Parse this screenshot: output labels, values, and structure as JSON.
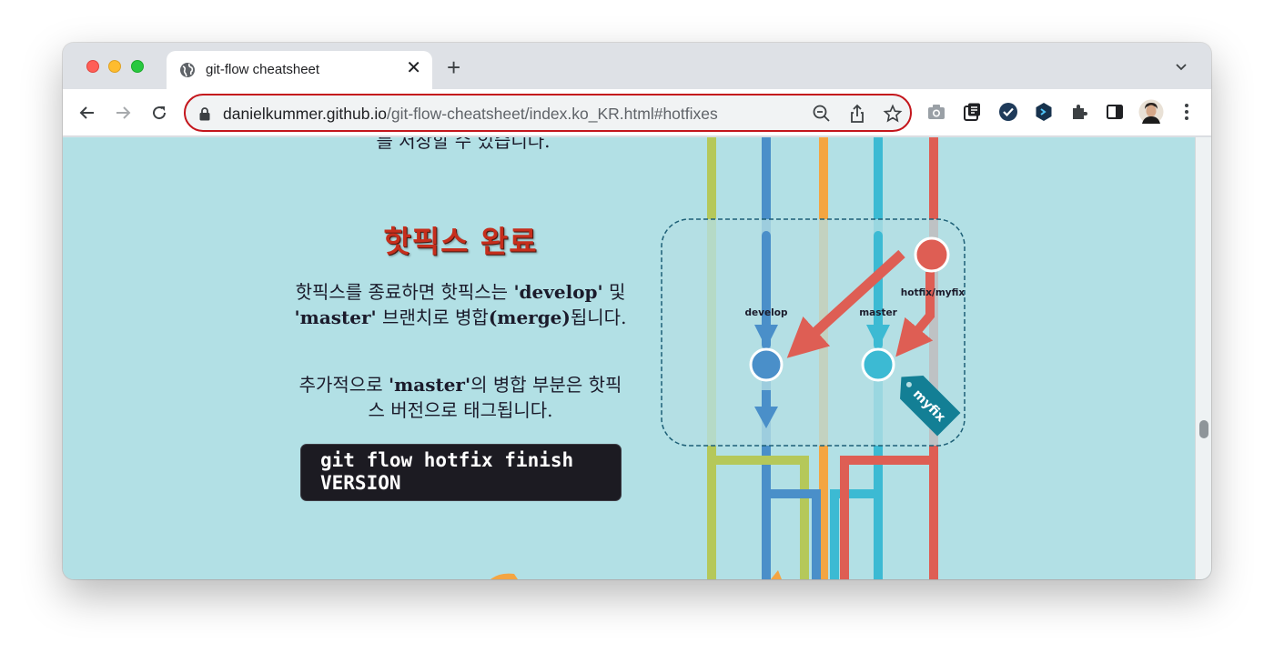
{
  "browser": {
    "tab_title": "git-flow cheatsheet",
    "tab_close": "✕",
    "new_tab": "+",
    "url_host": "danielkummer.github.io",
    "url_path": "/git-flow-cheatsheet/index.ko_KR.html#hotfixes"
  },
  "page": {
    "cut_off_text": "를 저장할 수 있습니다.",
    "section_title": "핫픽스 완료",
    "para1_text1": "핫픽스를 종료하면 핫픽스는 ",
    "para1_bold1": "'develop'",
    "para1_text2": " 및 ",
    "para1_bold2": "'master'",
    "para1_text3": " 브랜치로 병합",
    "para1_bold3": "(merge)",
    "para1_text4": "됩니다.",
    "para2_text1": "추가적으로 ",
    "para2_bold1": "'master'",
    "para2_text2": "의 병합 부분은 핫픽스 버전으로 태그됩니다.",
    "code": "git flow hotfix finish\nVERSION"
  },
  "diagram": {
    "label_develop": "develop",
    "label_master": "master",
    "label_hotfix": "hotfix/myfix",
    "tag_label": "myfix",
    "colors": {
      "develop": "#4a8fc9",
      "master": "#3cbad3",
      "hotfix": "#de5e54",
      "feature": "#b5c85a",
      "release": "#f4a542",
      "tag": "#137f95"
    }
  }
}
